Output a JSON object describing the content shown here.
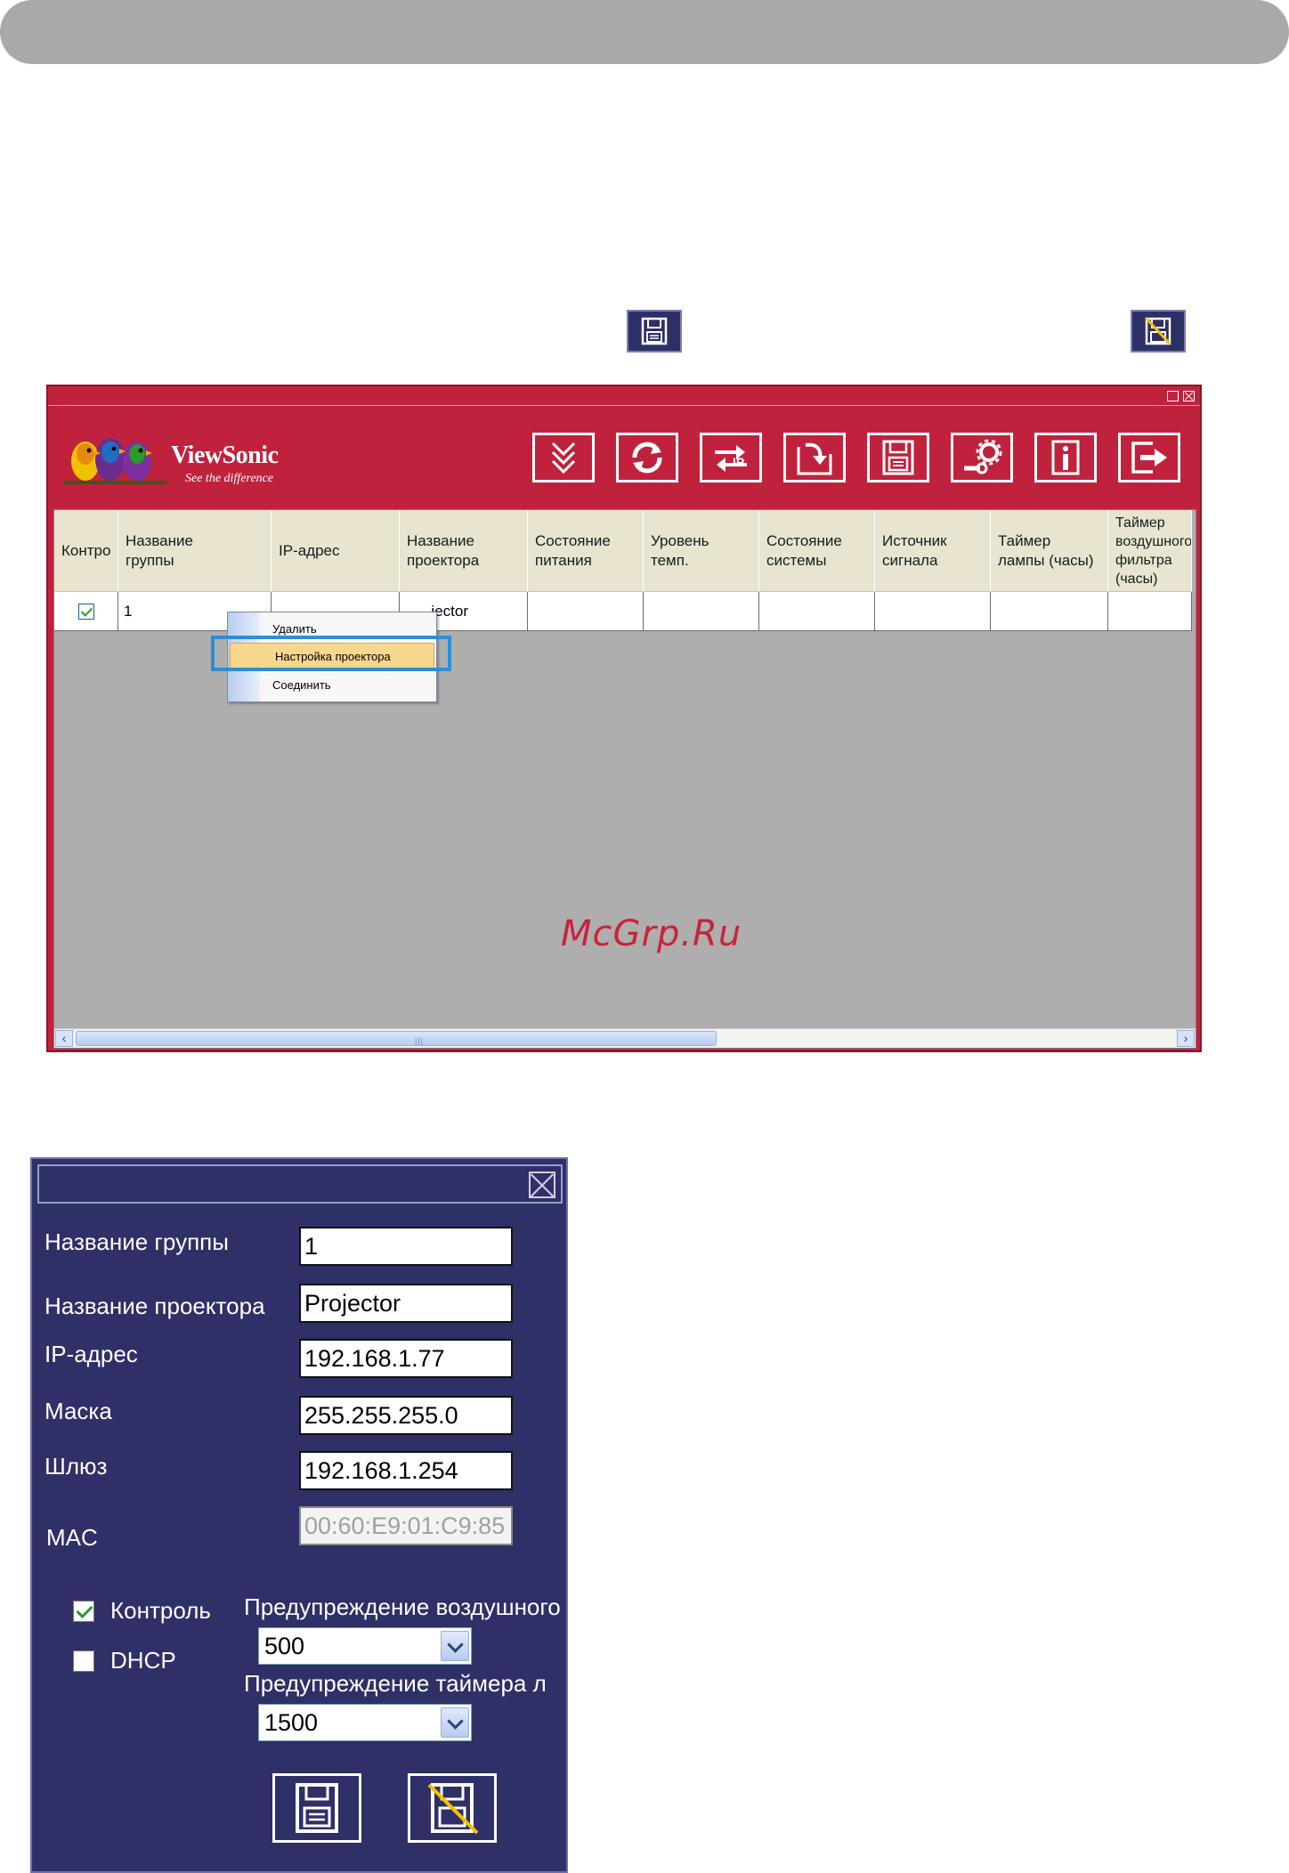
{
  "table": {
    "headers": [
      "Контро",
      "Название\nгруппы",
      "IP-адрес",
      "Название\nпроектора",
      "Состояние\nпитания",
      "Уровень\nтемп.",
      "Состояние\nсистемы",
      "Источник\nсигнала",
      "Таймер\nлампы (часы)",
      "Таймер\nвоздушного\nфильтра\n(часы)"
    ],
    "row": {
      "group": "1",
      "projector": "jector"
    }
  },
  "app": {
    "brand": "ViewSonic",
    "tagline": "See the difference"
  },
  "context_menu": {
    "items": [
      "Удалить",
      "Настройка проектора",
      "Соединить"
    ]
  },
  "watermark": "McGrp.Ru",
  "dialog": {
    "group_label": "Название группы",
    "group_value": "1",
    "projector_label": "Название проектора",
    "projector_value": "Projector",
    "ip_label": "IP-адрес",
    "ip_value": "192.168.1.77",
    "mask_label": "Маска",
    "mask_value": "255.255.255.0",
    "gateway_label": "Шлюз",
    "gateway_value": "192.168.1.254",
    "mac_label": "MAC",
    "mac_value": "00:60:E9:01:C9:85",
    "control_label": "Контроль",
    "dhcp_label": "DHCP",
    "filter_warn_label": "Предупреждение воздушного",
    "filter_warn_value": "500",
    "lamp_warn_label": "Предупреждение таймера л",
    "lamp_warn_value": "1500"
  },
  "icons": {
    "save": "floppy-save-icon",
    "cancel": "floppy-cancel-icon",
    "toolbar": [
      "double-chevron-down-icon",
      "refresh-icon",
      "ip-exchange-icon",
      "import-icon",
      "save-icon",
      "wrench-settings-icon",
      "info-icon",
      "exit-icon"
    ]
  },
  "colors": {
    "app_red": "#c0223d",
    "dialog_navy": "#2e3067",
    "header_gray": "#a9a9ab"
  }
}
